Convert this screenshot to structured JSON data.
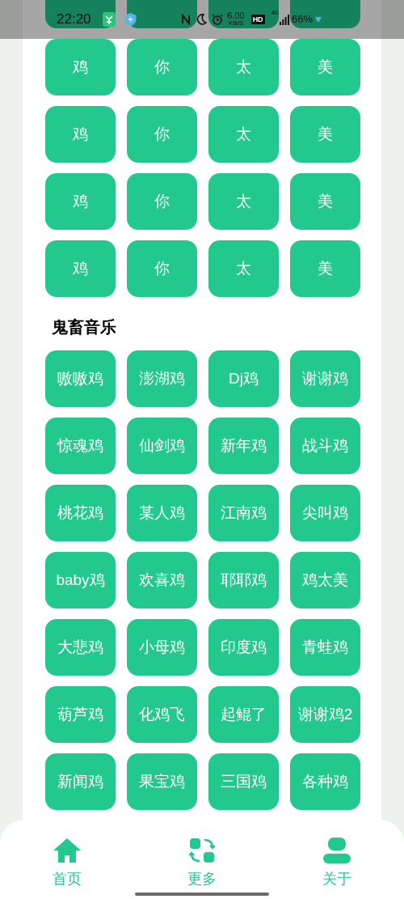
{
  "status_bar": {
    "time": "22:20",
    "speed": "6.00",
    "speed_unit": "KB/S",
    "hd": "HD",
    "network": "4G",
    "battery": "66%"
  },
  "sections": [
    {
      "buttons": [
        "鸡",
        "你",
        "太",
        "美",
        "鸡",
        "你",
        "太",
        "美",
        "鸡",
        "你",
        "太",
        "美",
        "鸡",
        "你",
        "太",
        "美"
      ]
    },
    {
      "title": "鬼畜音乐",
      "buttons": [
        "嗷嗷鸡",
        "澎湖鸡",
        "Dj鸡",
        "谢谢鸡",
        "惊魂鸡",
        "仙剑鸡",
        "新年鸡",
        "战斗鸡",
        "桃花鸡",
        "某人鸡",
        "江南鸡",
        "尖叫鸡",
        "baby鸡",
        "欢喜鸡",
        "耶耶鸡",
        "鸡太美",
        "大悲鸡",
        "小母鸡",
        "印度鸡",
        "青蛙鸡",
        "葫芦鸡",
        "化鸡飞",
        "起鲲了",
        "谢谢鸡2",
        "新闻鸡",
        "果宝鸡",
        "三国鸡",
        "各种鸡"
      ]
    }
  ],
  "nav": [
    {
      "label": "首页",
      "kind": "home"
    },
    {
      "label": "更多",
      "kind": "swap"
    },
    {
      "label": "关于",
      "kind": "person"
    }
  ]
}
